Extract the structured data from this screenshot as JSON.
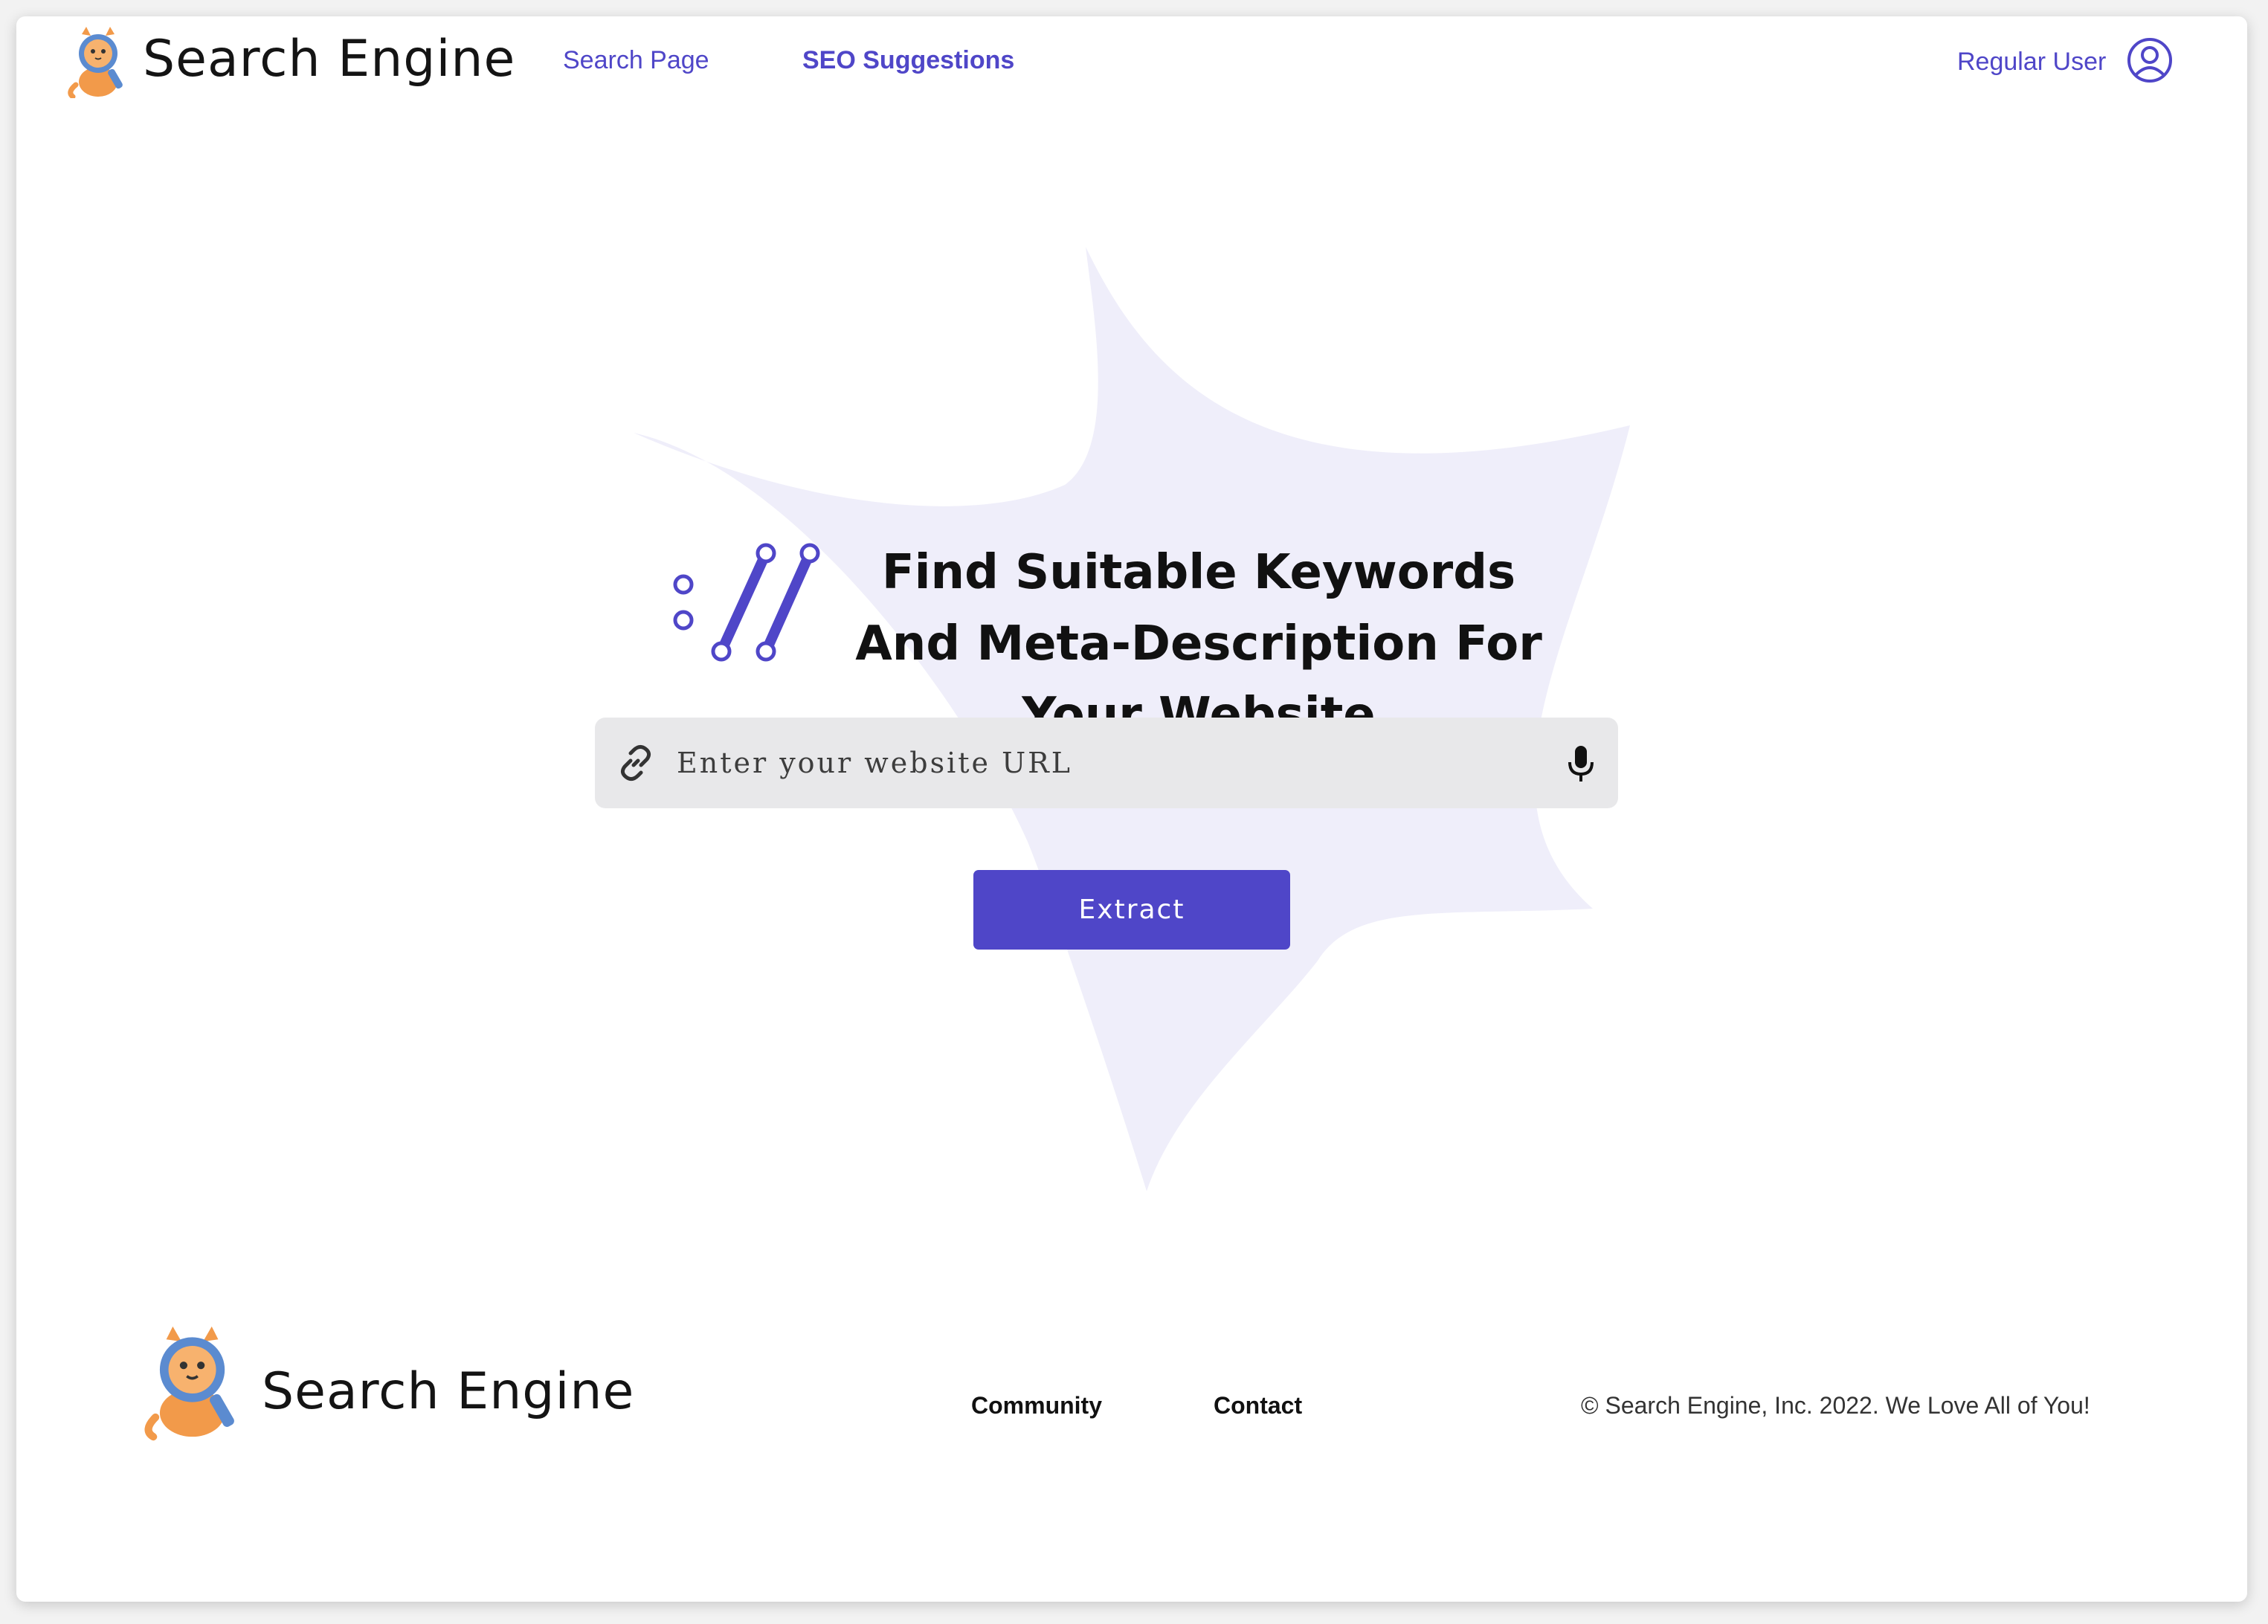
{
  "header": {
    "brand": "Search Engine",
    "nav": [
      {
        "label": "Search Page"
      },
      {
        "label": "SEO Suggestions"
      }
    ],
    "user_label": "Regular User",
    "logo_icon": "cat-magnifier-logo",
    "user_icon": "user-circle-icon"
  },
  "hero": {
    "headline": "Find Suitable Keywords And Meta-Description For Your Website",
    "search": {
      "placeholder": "Enter your website URL",
      "value": "",
      "left_icon": "link-icon",
      "right_icon": "microphone-icon"
    },
    "extract_label": "Extract",
    "decor_icon": "slash-dots-icon"
  },
  "footer": {
    "brand": "Search Engine",
    "links": [
      {
        "label": "Community"
      },
      {
        "label": "Contact"
      }
    ],
    "copyright": "© Search Engine, Inc. 2022.  We Love All of You!"
  },
  "colors": {
    "accent": "#4f46c8",
    "blob": "#efeefa",
    "search_bg": "#e8e8ea",
    "cat_orange": "#f29a4a",
    "cat_blue": "#5b8bd0"
  }
}
